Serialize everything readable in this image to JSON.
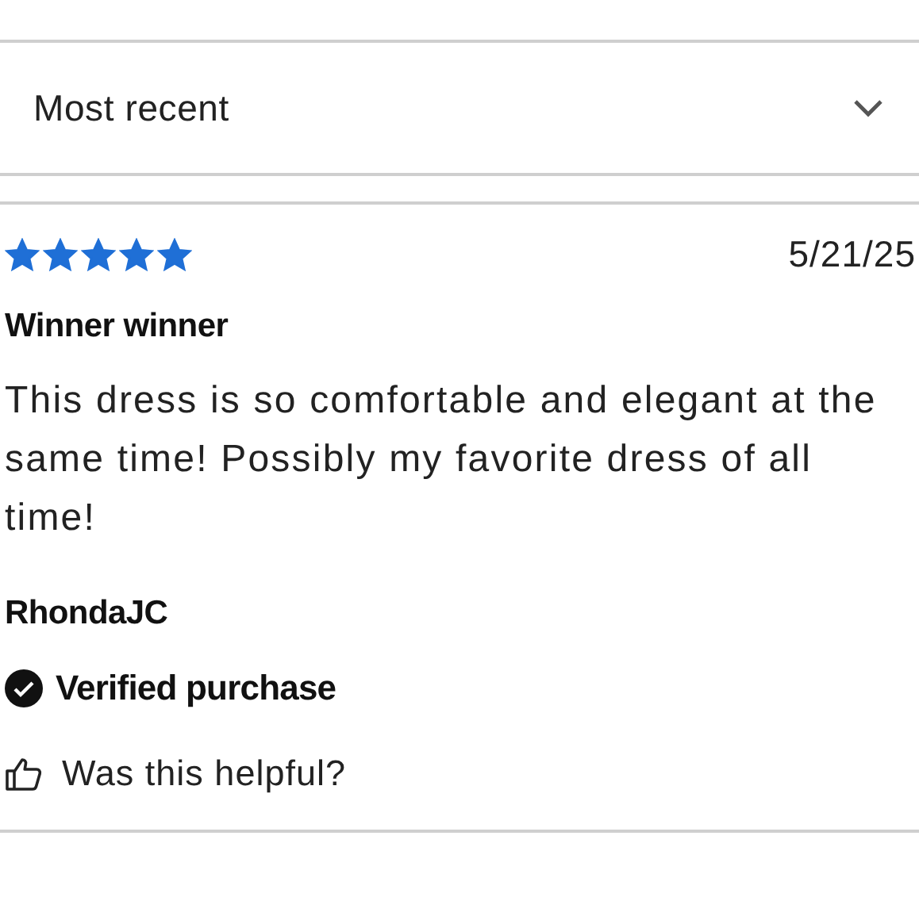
{
  "sort": {
    "value": "Most recent"
  },
  "review": {
    "stars": 5,
    "date": "5/21/25",
    "title": "Winner winner",
    "body": "This dress is so comfortable and elegant at the same time! Possibly my favorite dress of all time!",
    "author": "RhondaJC",
    "badge": "Verified purchase",
    "helpful": "Was this helpful?"
  }
}
